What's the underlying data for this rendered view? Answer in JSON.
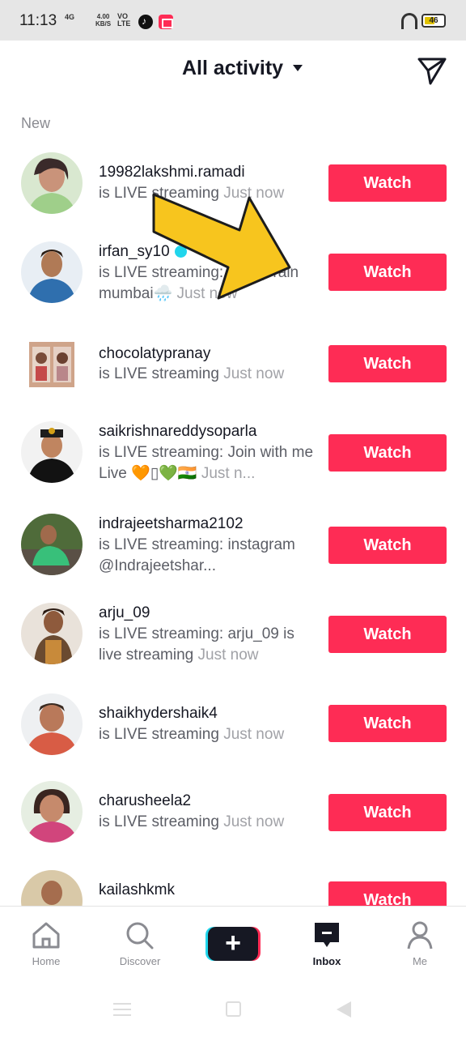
{
  "status_bar": {
    "time": "11:13",
    "signal": "4G",
    "speed_value": "4.00",
    "speed_unit": "KB/S",
    "volte_top": "VO",
    "volte_bottom": "LTE",
    "battery": "46"
  },
  "header": {
    "title": "All activity"
  },
  "section_label": "New",
  "watch_label": "Watch",
  "activities": [
    {
      "username": "19982lakshmi.ramadi",
      "text": "is LIVE streaming",
      "time": "Just now"
    },
    {
      "username": "irfan_sy10",
      "text": "is LIVE streaming: heavy rain mumbai🌧️",
      "time": "Just now"
    },
    {
      "username": "chocolatypranay",
      "text": "is LIVE streaming",
      "time": "Just now"
    },
    {
      "username": "saikrishnareddysoparla",
      "text": "is LIVE streaming: Join with me Live 🧡▯💚🇮🇳",
      "time": "Just n..."
    },
    {
      "username": "indrajeetsharma2102",
      "text": "is LIVE streaming: instagram @Indrajeetshar...",
      "time": ""
    },
    {
      "username": "arju_09",
      "text": "is LIVE streaming: arju_09 is live streaming",
      "time": "Just now"
    },
    {
      "username": "shaikhydershaik4",
      "text": "is LIVE streaming",
      "time": "Just now"
    },
    {
      "username": "charusheela2",
      "text": "is LIVE streaming",
      "time": "Just now"
    },
    {
      "username": "kailashkmk",
      "text": "",
      "time": ""
    }
  ],
  "bottom_nav": {
    "home": "Home",
    "discover": "Discover",
    "create": "+",
    "inbox": "Inbox",
    "me": "Me"
  },
  "colors": {
    "accent": "#fe2c55",
    "cyan": "#20d5ec",
    "text": "#161823",
    "muted": "#8a8b91"
  }
}
